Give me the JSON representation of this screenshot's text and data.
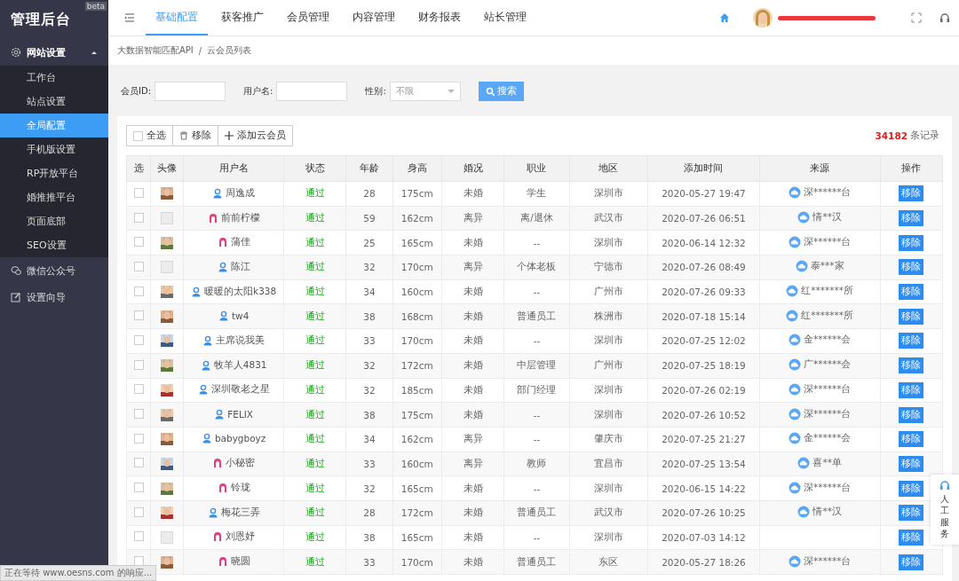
{
  "sidebar": {
    "logo": "管理后台",
    "badge": "beta",
    "groups": [
      {
        "label": "网站设置",
        "kind": "gear",
        "expanded": true,
        "items": [
          {
            "label": "工作台",
            "selected": false
          },
          {
            "label": "站点设置",
            "selected": false
          },
          {
            "label": "全局配置",
            "selected": true
          },
          {
            "label": "手机版设置",
            "selected": false
          },
          {
            "label": "RP开放平台",
            "selected": false
          },
          {
            "label": "婚推推平台",
            "selected": false
          },
          {
            "label": "页面底部",
            "selected": false
          },
          {
            "label": "SEO设置",
            "selected": false
          }
        ]
      },
      {
        "label": "微信公众号",
        "kind": "chat",
        "expanded": false
      },
      {
        "label": "设置向导",
        "kind": "edit",
        "expanded": false
      }
    ]
  },
  "topbar": {
    "tabs": [
      {
        "label": "基础配置",
        "selected": true
      },
      {
        "label": "获客推广",
        "selected": false
      },
      {
        "label": "会员管理",
        "selected": false
      },
      {
        "label": "内容管理",
        "selected": false
      },
      {
        "label": "财务报表",
        "selected": false
      },
      {
        "label": "站长管理",
        "selected": false
      }
    ]
  },
  "breadcrumb": {
    "items": [
      "大数据智能匹配API",
      "云会员列表"
    ],
    "separator": "/"
  },
  "filters": {
    "member_id_label": "会员ID:",
    "username_label": "用户名:",
    "gender_label": "性别:",
    "gender_value": "不限",
    "search_button": "搜索"
  },
  "toolbar": {
    "select_all_checked": false,
    "select_all": "全选",
    "remove": "移除",
    "add": "添加云会员",
    "count": "34182",
    "count_suffix": "条记录"
  },
  "table": {
    "columns": [
      "选",
      "头像",
      "用户名",
      "状态",
      "年龄",
      "身高",
      "婚况",
      "职业",
      "地区",
      "添加时间",
      "来源",
      "操作"
    ],
    "rows": [
      {
        "checked": false,
        "avatar": true,
        "kind": "male",
        "name": "周逸成",
        "status": "通过",
        "age": "28",
        "height": "175cm",
        "marital": "未婚",
        "job": "学生",
        "region": "深圳市",
        "added": "2020-05-27 19:47",
        "source": "深******台",
        "action": "移除"
      },
      {
        "checked": false,
        "avatar": false,
        "kind": "female",
        "name": "前前柠檬",
        "status": "通过",
        "age": "59",
        "height": "162cm",
        "marital": "离异",
        "job": "离/退休",
        "region": "武汉市",
        "added": "2020-07-26 06:51",
        "source": "情**汉",
        "action": "移除"
      },
      {
        "checked": false,
        "avatar": true,
        "kind": "female",
        "name": "蒲佳",
        "status": "通过",
        "age": "25",
        "height": "165cm",
        "marital": "未婚",
        "job": "--",
        "region": "深圳市",
        "added": "2020-06-14 12:32",
        "source": "深******台",
        "action": "移除"
      },
      {
        "checked": false,
        "avatar": false,
        "kind": "male",
        "name": "陈江",
        "status": "通过",
        "age": "32",
        "height": "170cm",
        "marital": "离异",
        "job": "个体老板",
        "region": "宁德市",
        "added": "2020-07-26 08:49",
        "source": "泰***家",
        "action": "移除"
      },
      {
        "checked": false,
        "avatar": true,
        "kind": "male",
        "name": "暖暖的太阳k338",
        "status": "通过",
        "age": "34",
        "height": "160cm",
        "marital": "未婚",
        "job": "--",
        "region": "广州市",
        "added": "2020-07-26 09:33",
        "source": "红*******所",
        "action": "移除"
      },
      {
        "checked": false,
        "avatar": true,
        "kind": "male",
        "name": "tw4",
        "status": "通过",
        "age": "38",
        "height": "168cm",
        "marital": "未婚",
        "job": "普通员工",
        "region": "株洲市",
        "added": "2020-07-18 15:14",
        "source": "红*******所",
        "action": "移除"
      },
      {
        "checked": false,
        "avatar": true,
        "kind": "male",
        "name": "主席说我美",
        "status": "通过",
        "age": "33",
        "height": "170cm",
        "marital": "未婚",
        "job": "--",
        "region": "深圳市",
        "added": "2020-07-25 12:02",
        "source": "金******会",
        "action": "移除"
      },
      {
        "checked": false,
        "avatar": true,
        "kind": "male",
        "name": "牧羊人4831",
        "status": "通过",
        "age": "32",
        "height": "172cm",
        "marital": "未婚",
        "job": "中层管理",
        "region": "广州市",
        "added": "2020-07-25 18:19",
        "source": "广******会",
        "action": "移除"
      },
      {
        "checked": false,
        "avatar": true,
        "kind": "male",
        "name": "深圳敬老之星",
        "status": "通过",
        "age": "32",
        "height": "185cm",
        "marital": "未婚",
        "job": "部门经理",
        "region": "深圳市",
        "added": "2020-07-26 02:19",
        "source": "深******台",
        "action": "移除"
      },
      {
        "checked": false,
        "avatar": true,
        "kind": "male",
        "name": "FELIX",
        "status": "通过",
        "age": "38",
        "height": "175cm",
        "marital": "未婚",
        "job": "--",
        "region": "深圳市",
        "added": "2020-07-26 10:52",
        "source": "深******台",
        "action": "移除"
      },
      {
        "checked": false,
        "avatar": true,
        "kind": "male",
        "name": "babygboyz",
        "status": "通过",
        "age": "34",
        "height": "162cm",
        "marital": "离异",
        "job": "--",
        "region": "肇庆市",
        "added": "2020-07-25 21:27",
        "source": "金******会",
        "action": "移除"
      },
      {
        "checked": false,
        "avatar": true,
        "kind": "female",
        "name": "小秘密",
        "status": "通过",
        "age": "33",
        "height": "160cm",
        "marital": "离异",
        "job": "教师",
        "region": "宜昌市",
        "added": "2020-07-25 13:54",
        "source": "喜**单",
        "action": "移除"
      },
      {
        "checked": false,
        "avatar": true,
        "kind": "female",
        "name": "铃珑",
        "status": "通过",
        "age": "32",
        "height": "165cm",
        "marital": "未婚",
        "job": "--",
        "region": "深圳市",
        "added": "2020-06-15 14:22",
        "source": "深******台",
        "action": "移除"
      },
      {
        "checked": false,
        "avatar": true,
        "kind": "male",
        "name": "梅花三弄",
        "status": "通过",
        "age": "28",
        "height": "172cm",
        "marital": "未婚",
        "job": "普通员工",
        "region": "武汉市",
        "added": "2020-07-26 10:25",
        "source": "情**汉",
        "action": "移除"
      },
      {
        "checked": false,
        "avatar": false,
        "kind": "female",
        "name": "刘恩妤",
        "status": "通过",
        "age": "38",
        "height": "165cm",
        "marital": "未婚",
        "job": "--",
        "region": "深圳市",
        "added": "2020-07-03 14:12",
        "action": "移除"
      },
      {
        "checked": false,
        "avatar": true,
        "kind": "female",
        "name": "晓圆",
        "status": "通过",
        "age": "33",
        "height": "170cm",
        "marital": "未婚",
        "job": "普通员工",
        "region": "东区",
        "added": "2020-05-27 18:26",
        "source": "深******台",
        "action": "移除"
      }
    ]
  },
  "service_widget": {
    "label": "人工服务"
  },
  "status_bar": "正在等待 www.oesns.com 的响应..."
}
